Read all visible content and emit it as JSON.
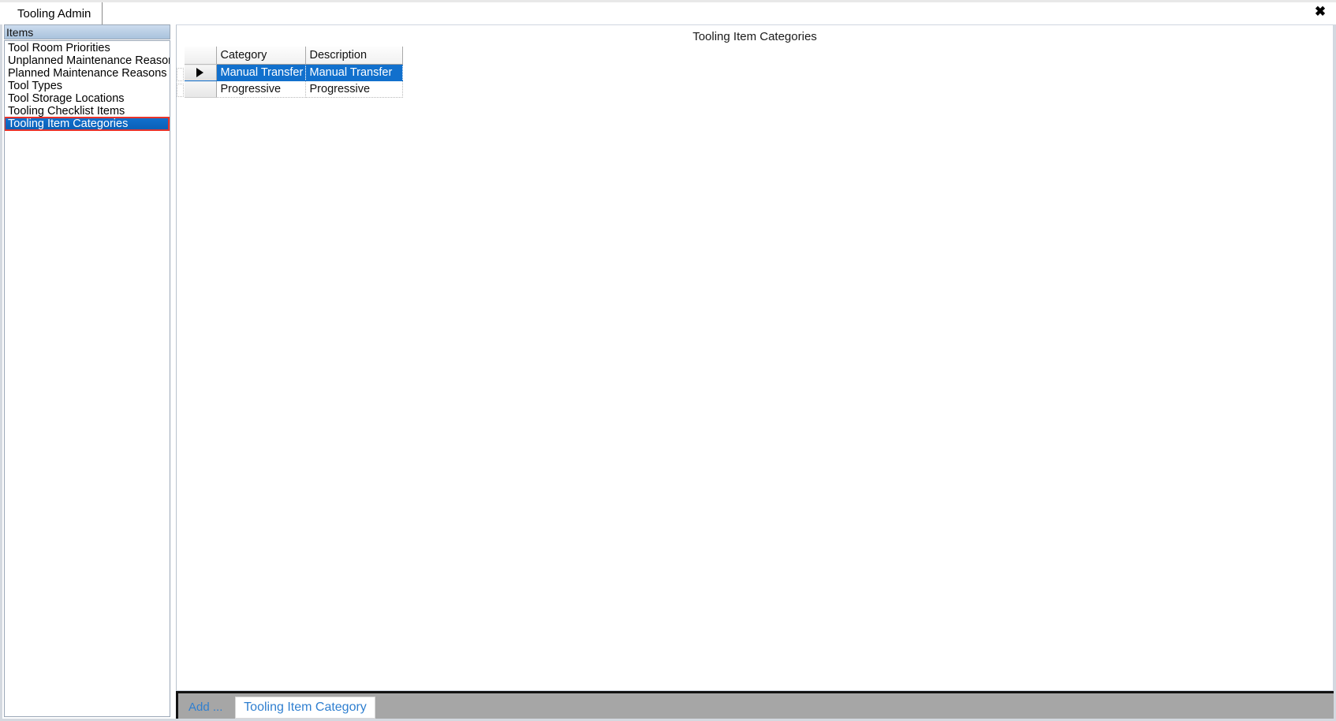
{
  "window": {
    "close_icon": "close-icon",
    "close_glyph": "✖"
  },
  "tabs": [
    {
      "label": "Tooling Admin",
      "active": true
    }
  ],
  "sidebar": {
    "header": "Items",
    "items": [
      {
        "label": "Tool Room Priorities",
        "selected": false
      },
      {
        "label": "Unplanned Maintenance Reasons",
        "selected": false
      },
      {
        "label": "Planned Maintenance Reasons",
        "selected": false
      },
      {
        "label": "Tool Types",
        "selected": false
      },
      {
        "label": "Tool Storage Locations",
        "selected": false
      },
      {
        "label": "Tooling Checklist Items",
        "selected": false
      },
      {
        "label": "Tooling Item Categories",
        "selected": true
      }
    ]
  },
  "content": {
    "title": "Tooling Item Categories",
    "grid": {
      "selector_column_header": "",
      "columns": [
        "Category",
        "Description"
      ],
      "rows": [
        {
          "selected": true,
          "marker": "▶",
          "Category": "Manual Transfer",
          "Description": "Manual Transfer"
        },
        {
          "selected": false,
          "marker": "",
          "Category": "Progressive",
          "Description": "Progressive"
        }
      ]
    }
  },
  "action_bar": {
    "add_label": "Add ...",
    "add_button_label": "Tooling Item Category"
  },
  "colors": {
    "selection_blue": "#1170cd",
    "highlight_red": "#e8342b",
    "link_blue": "#2f7fd0",
    "action_bar_gray": "#a6a6a6",
    "sidebar_header_blue": "#bcd0e6"
  }
}
